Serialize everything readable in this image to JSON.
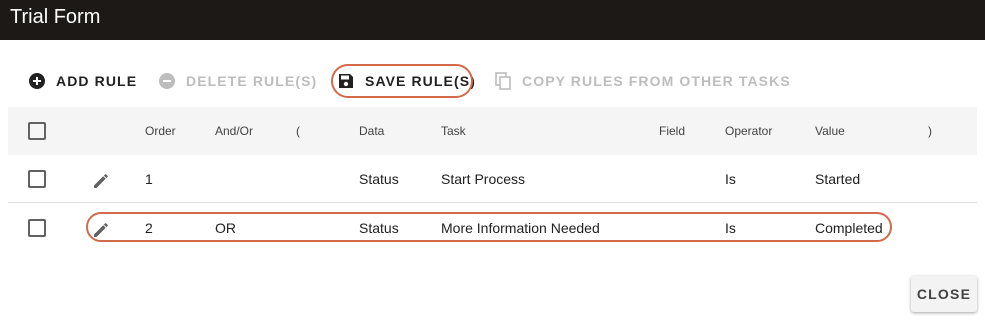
{
  "window": {
    "title": "Trial Form"
  },
  "toolbar": {
    "add_label": "ADD RULE",
    "delete_label": "DELETE RULE(S)",
    "save_label": "SAVE RULE(S)",
    "copy_label": "COPY RULES FROM OTHER TASKS"
  },
  "table": {
    "headers": {
      "order": "Order",
      "andor": "And/Or",
      "open_paren": "(",
      "data": "Data",
      "task": "Task",
      "field": "Field",
      "operator": "Operator",
      "value": "Value",
      "close_paren": ")"
    },
    "rows": [
      {
        "order": "1",
        "andor": "",
        "open_paren": "",
        "data": "Status",
        "task": "Start Process",
        "field": "",
        "operator": "Is",
        "value": "Started",
        "close_paren": ""
      },
      {
        "order": "2",
        "andor": "OR",
        "open_paren": "",
        "data": "Status",
        "task": "More Information Needed",
        "field": "",
        "operator": "Is",
        "value": "Completed",
        "close_paren": ""
      }
    ]
  },
  "footer": {
    "close_label": "CLOSE"
  },
  "colors": {
    "titlebar_bg": "#1c1917",
    "highlight": "#d4694b",
    "disabled_text": "#bdbdbd"
  },
  "icons": {
    "add": "add-circle-icon",
    "delete": "remove-circle-icon",
    "save": "floppy-disk-icon",
    "copy": "copy-icon",
    "edit": "pencil-icon"
  }
}
